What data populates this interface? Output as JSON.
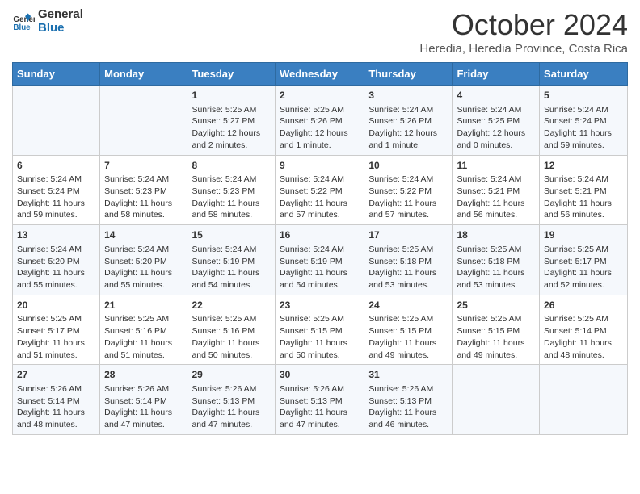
{
  "logo": {
    "line1": "General",
    "line2": "Blue"
  },
  "title": "October 2024",
  "subtitle": "Heredia, Heredia Province, Costa Rica",
  "days_of_week": [
    "Sunday",
    "Monday",
    "Tuesday",
    "Wednesday",
    "Thursday",
    "Friday",
    "Saturday"
  ],
  "weeks": [
    [
      {
        "day": "",
        "content": ""
      },
      {
        "day": "",
        "content": ""
      },
      {
        "day": "1",
        "content": "Sunrise: 5:25 AM\nSunset: 5:27 PM\nDaylight: 12 hours and 2 minutes."
      },
      {
        "day": "2",
        "content": "Sunrise: 5:25 AM\nSunset: 5:26 PM\nDaylight: 12 hours and 1 minute."
      },
      {
        "day": "3",
        "content": "Sunrise: 5:24 AM\nSunset: 5:26 PM\nDaylight: 12 hours and 1 minute."
      },
      {
        "day": "4",
        "content": "Sunrise: 5:24 AM\nSunset: 5:25 PM\nDaylight: 12 hours and 0 minutes."
      },
      {
        "day": "5",
        "content": "Sunrise: 5:24 AM\nSunset: 5:24 PM\nDaylight: 11 hours and 59 minutes."
      }
    ],
    [
      {
        "day": "6",
        "content": "Sunrise: 5:24 AM\nSunset: 5:24 PM\nDaylight: 11 hours and 59 minutes."
      },
      {
        "day": "7",
        "content": "Sunrise: 5:24 AM\nSunset: 5:23 PM\nDaylight: 11 hours and 58 minutes."
      },
      {
        "day": "8",
        "content": "Sunrise: 5:24 AM\nSunset: 5:23 PM\nDaylight: 11 hours and 58 minutes."
      },
      {
        "day": "9",
        "content": "Sunrise: 5:24 AM\nSunset: 5:22 PM\nDaylight: 11 hours and 57 minutes."
      },
      {
        "day": "10",
        "content": "Sunrise: 5:24 AM\nSunset: 5:22 PM\nDaylight: 11 hours and 57 minutes."
      },
      {
        "day": "11",
        "content": "Sunrise: 5:24 AM\nSunset: 5:21 PM\nDaylight: 11 hours and 56 minutes."
      },
      {
        "day": "12",
        "content": "Sunrise: 5:24 AM\nSunset: 5:21 PM\nDaylight: 11 hours and 56 minutes."
      }
    ],
    [
      {
        "day": "13",
        "content": "Sunrise: 5:24 AM\nSunset: 5:20 PM\nDaylight: 11 hours and 55 minutes."
      },
      {
        "day": "14",
        "content": "Sunrise: 5:24 AM\nSunset: 5:20 PM\nDaylight: 11 hours and 55 minutes."
      },
      {
        "day": "15",
        "content": "Sunrise: 5:24 AM\nSunset: 5:19 PM\nDaylight: 11 hours and 54 minutes."
      },
      {
        "day": "16",
        "content": "Sunrise: 5:24 AM\nSunset: 5:19 PM\nDaylight: 11 hours and 54 minutes."
      },
      {
        "day": "17",
        "content": "Sunrise: 5:25 AM\nSunset: 5:18 PM\nDaylight: 11 hours and 53 minutes."
      },
      {
        "day": "18",
        "content": "Sunrise: 5:25 AM\nSunset: 5:18 PM\nDaylight: 11 hours and 53 minutes."
      },
      {
        "day": "19",
        "content": "Sunrise: 5:25 AM\nSunset: 5:17 PM\nDaylight: 11 hours and 52 minutes."
      }
    ],
    [
      {
        "day": "20",
        "content": "Sunrise: 5:25 AM\nSunset: 5:17 PM\nDaylight: 11 hours and 51 minutes."
      },
      {
        "day": "21",
        "content": "Sunrise: 5:25 AM\nSunset: 5:16 PM\nDaylight: 11 hours and 51 minutes."
      },
      {
        "day": "22",
        "content": "Sunrise: 5:25 AM\nSunset: 5:16 PM\nDaylight: 11 hours and 50 minutes."
      },
      {
        "day": "23",
        "content": "Sunrise: 5:25 AM\nSunset: 5:15 PM\nDaylight: 11 hours and 50 minutes."
      },
      {
        "day": "24",
        "content": "Sunrise: 5:25 AM\nSunset: 5:15 PM\nDaylight: 11 hours and 49 minutes."
      },
      {
        "day": "25",
        "content": "Sunrise: 5:25 AM\nSunset: 5:15 PM\nDaylight: 11 hours and 49 minutes."
      },
      {
        "day": "26",
        "content": "Sunrise: 5:25 AM\nSunset: 5:14 PM\nDaylight: 11 hours and 48 minutes."
      }
    ],
    [
      {
        "day": "27",
        "content": "Sunrise: 5:26 AM\nSunset: 5:14 PM\nDaylight: 11 hours and 48 minutes."
      },
      {
        "day": "28",
        "content": "Sunrise: 5:26 AM\nSunset: 5:14 PM\nDaylight: 11 hours and 47 minutes."
      },
      {
        "day": "29",
        "content": "Sunrise: 5:26 AM\nSunset: 5:13 PM\nDaylight: 11 hours and 47 minutes."
      },
      {
        "day": "30",
        "content": "Sunrise: 5:26 AM\nSunset: 5:13 PM\nDaylight: 11 hours and 47 minutes."
      },
      {
        "day": "31",
        "content": "Sunrise: 5:26 AM\nSunset: 5:13 PM\nDaylight: 11 hours and 46 minutes."
      },
      {
        "day": "",
        "content": ""
      },
      {
        "day": "",
        "content": ""
      }
    ]
  ]
}
